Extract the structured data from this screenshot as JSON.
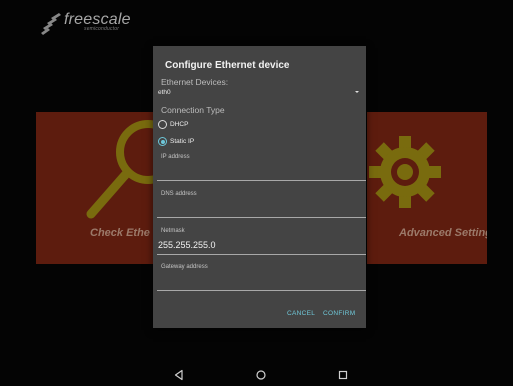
{
  "brand": {
    "name": "freescale",
    "subtitle": "semiconductor"
  },
  "background_panels": {
    "left_label": "Check Ethe",
    "right_label": "Advanced Setting"
  },
  "dialog": {
    "title": "Configure Ethernet device",
    "devices_label": "Ethernet Devices:",
    "device_value": "eth0",
    "connection_type_label": "Connection Type",
    "options": [
      "DHCP",
      "Static IP"
    ],
    "selected_option": "Static IP",
    "fields": {
      "ip_label": "IP address",
      "ip_value": "",
      "dns_label": "DNS address",
      "dns_value": "",
      "netmask_label": "Netmask",
      "netmask_value": "255.255.255.0",
      "gateway_label": "Gateway address",
      "gateway_value": ""
    },
    "buttons": {
      "cancel": "CANCEL",
      "confirm": "CONFIRM"
    }
  },
  "navbar": {
    "icons": [
      "back-icon",
      "home-icon",
      "recents-icon"
    ]
  },
  "colors": {
    "accent": "#6dc7d9",
    "panel": "#6a2010",
    "icon": "#8a7a10",
    "dialog": "#444444"
  }
}
